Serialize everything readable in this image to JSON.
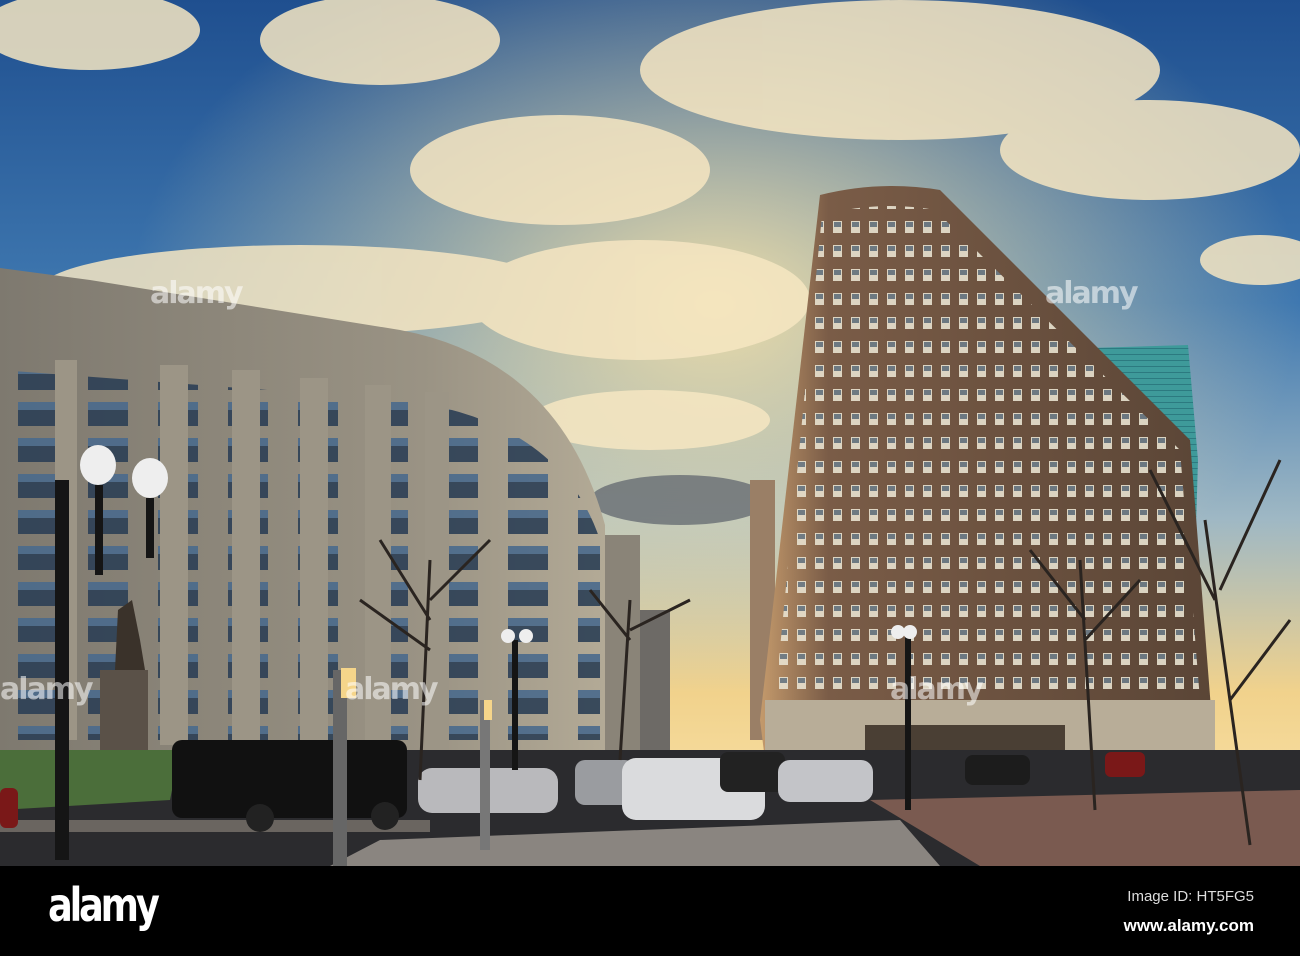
{
  "photo": {
    "subject": "city street corner at sunset",
    "colors": {
      "sky_top": "#2a5a9a",
      "sky_glow": "#f3d28a",
      "building_left": "#8d877c",
      "building_right": "#6e5645",
      "street": "#2b2b2e"
    }
  },
  "watermarks": [
    "alamy",
    "alamy",
    "alamy",
    "alamy",
    "alamy"
  ],
  "footer": {
    "logo": "alamy",
    "image_id": "Image ID: HT5FG5",
    "website": "www.alamy.com"
  }
}
